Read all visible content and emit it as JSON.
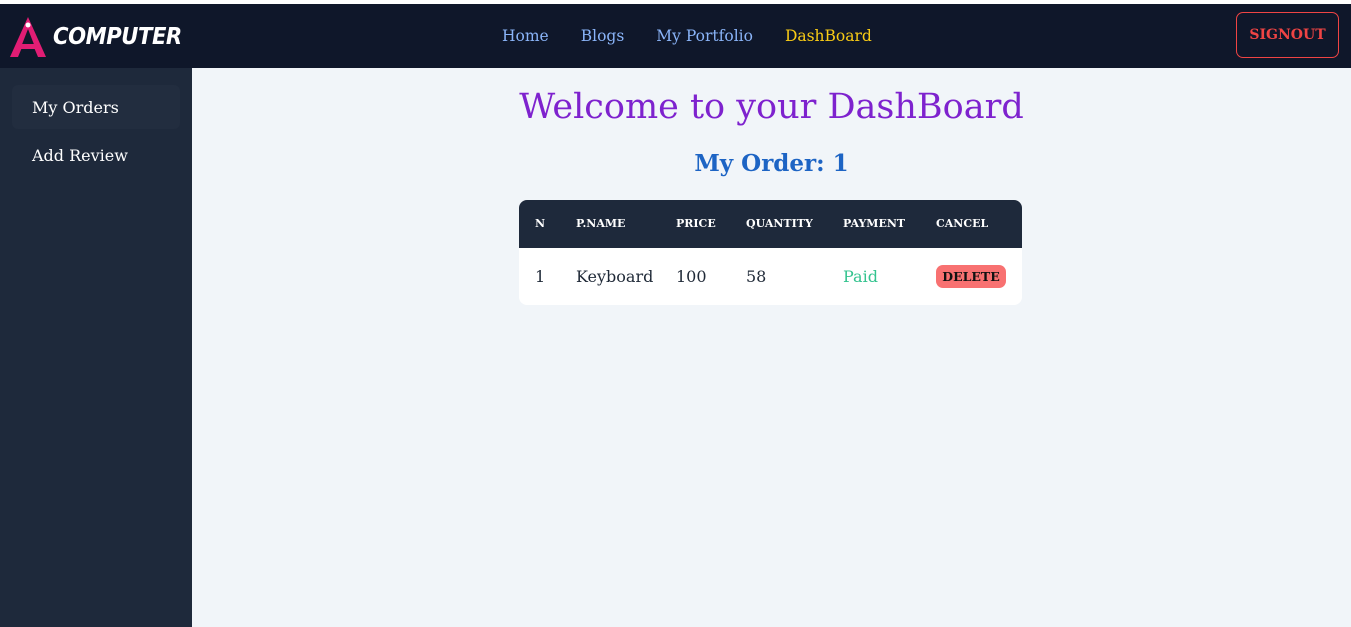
{
  "navbar": {
    "brand": "COMPUTER",
    "links": [
      {
        "label": "Home",
        "color": "#8ab4f8"
      },
      {
        "label": "Blogs",
        "color": "#8ab4f8"
      },
      {
        "label": "My Portfolio",
        "color": "#8ab4f8"
      },
      {
        "label": "DashBoard",
        "color": "#facc15"
      }
    ],
    "signout_label": "SIGNOUT"
  },
  "sidebar": {
    "items": [
      {
        "label": "My Orders",
        "active": true
      },
      {
        "label": "Add Review",
        "active": false
      }
    ]
  },
  "main": {
    "title": "Welcome to your DashBoard",
    "order_heading": "My Order: 1",
    "table": {
      "headers": [
        "N",
        "P.NAME",
        "PRICE",
        "QUANTITY",
        "PAYMENT",
        "CANCEL"
      ],
      "rows": [
        {
          "n": "1",
          "name": "Keyboard",
          "price": "100",
          "quantity": "58",
          "payment": "Paid",
          "cancel_label": "DELETE"
        }
      ]
    }
  },
  "colors": {
    "navbar_bg": "#0f172a",
    "sidebar_bg": "#1e293b",
    "main_bg": "#f1f5f9",
    "title": "#7e22ce",
    "heading": "#1d64c4",
    "logo_accent": "#e11d74",
    "signout": "#ef4444",
    "paid": "#34c38f",
    "delete_bg": "#f87171"
  },
  "icons": {
    "logo": "logo-icon"
  }
}
